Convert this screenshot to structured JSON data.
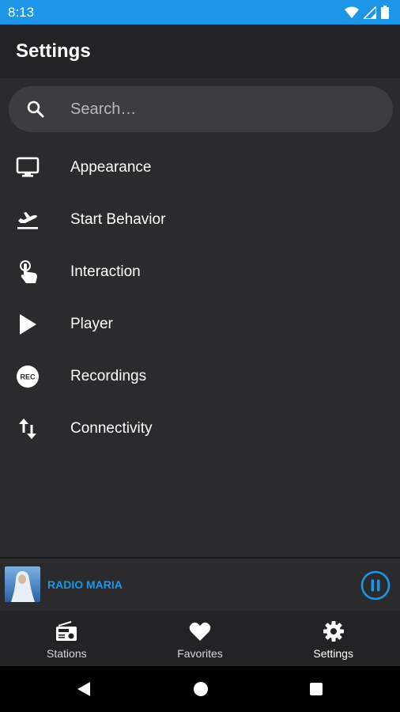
{
  "status_bar": {
    "time": "8:13"
  },
  "app_bar": {
    "title": "Settings"
  },
  "search": {
    "placeholder": "Search…"
  },
  "menu": {
    "items": [
      {
        "label": "Appearance",
        "icon": "monitor-icon"
      },
      {
        "label": "Start Behavior",
        "icon": "flight-takeoff-icon"
      },
      {
        "label": "Interaction",
        "icon": "touch-icon"
      },
      {
        "label": "Player",
        "icon": "play-icon"
      },
      {
        "label": "Recordings",
        "icon": "rec-icon",
        "badge": "REC"
      },
      {
        "label": "Connectivity",
        "icon": "swap-vertical-icon"
      }
    ]
  },
  "now_playing": {
    "station": "RADIO MARIA",
    "state": "playing"
  },
  "bottom_nav": {
    "items": [
      {
        "label": "Stations",
        "icon": "radio-icon"
      },
      {
        "label": "Favorites",
        "icon": "heart-icon"
      },
      {
        "label": "Settings",
        "icon": "gear-icon",
        "active": true
      }
    ]
  },
  "colors": {
    "accent": "#1e96e8",
    "background": "#2b2b2d",
    "bar": "#232325",
    "search_bg": "#3d3d3f"
  }
}
